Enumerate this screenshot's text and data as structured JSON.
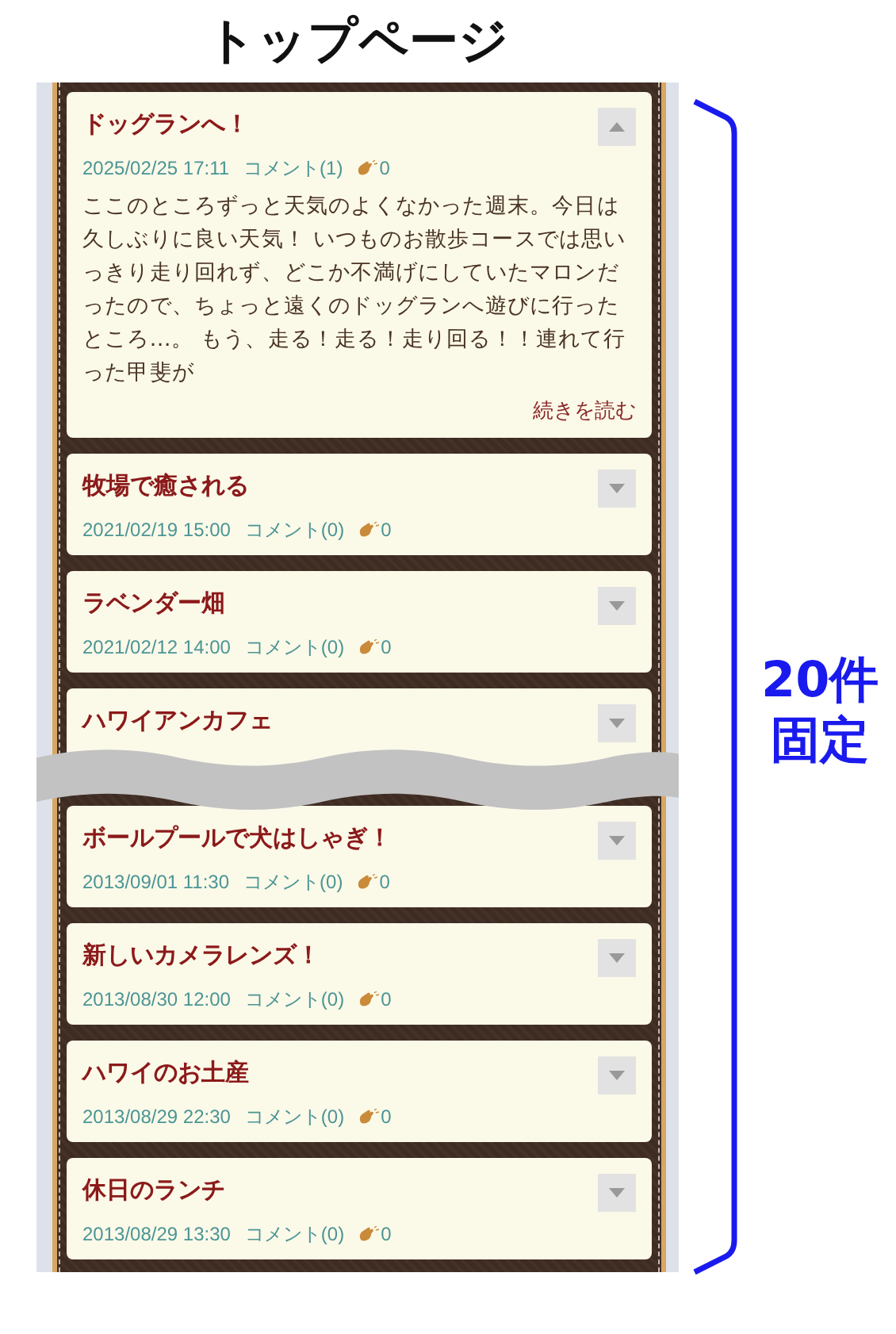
{
  "page_title": "トップページ",
  "posts": [
    {
      "title": "ドッグランへ！",
      "date": "2025/02/25 17:11",
      "comments": "コメント(1)",
      "claps": "0",
      "expanded": true,
      "body": "ここのところずっと天気のよくなかった週末。今日は久しぶりに良い天気！ いつものお散歩コースでは思いっきり走り回れず、どこか不満げにしていたマロンだったので、ちょっと遠くのドッグランへ遊びに行ったところ…。 もう、走る！走る！走り回る！！連れて行った甲斐が",
      "more": "続きを読む"
    },
    {
      "title": "牧場で癒される",
      "date": "2021/02/19 15:00",
      "comments": "コメント(0)",
      "claps": "0",
      "expanded": false
    },
    {
      "title": "ラベンダー畑",
      "date": "2021/02/12 14:00",
      "comments": "コメント(0)",
      "claps": "0",
      "expanded": false
    },
    {
      "title": "ハワイアンカフェ",
      "expanded": false
    },
    {
      "title": "ボールプールで犬はしゃぎ！",
      "date": "2013/09/01 11:30",
      "comments": "コメント(0)",
      "claps": "0",
      "expanded": false
    },
    {
      "title": "新しいカメラレンズ！",
      "date": "2013/08/30 12:00",
      "comments": "コメント(0)",
      "claps": "0",
      "expanded": false
    },
    {
      "title": "ハワイのお土産",
      "date": "2013/08/29 22:30",
      "comments": "コメント(0)",
      "claps": "0",
      "expanded": false
    },
    {
      "title": "休日のランチ",
      "date": "2013/08/29 13:30",
      "comments": "コメント(0)",
      "claps": "0",
      "expanded": false
    }
  ],
  "annotation": {
    "lines": [
      "20件",
      "固定"
    ]
  }
}
